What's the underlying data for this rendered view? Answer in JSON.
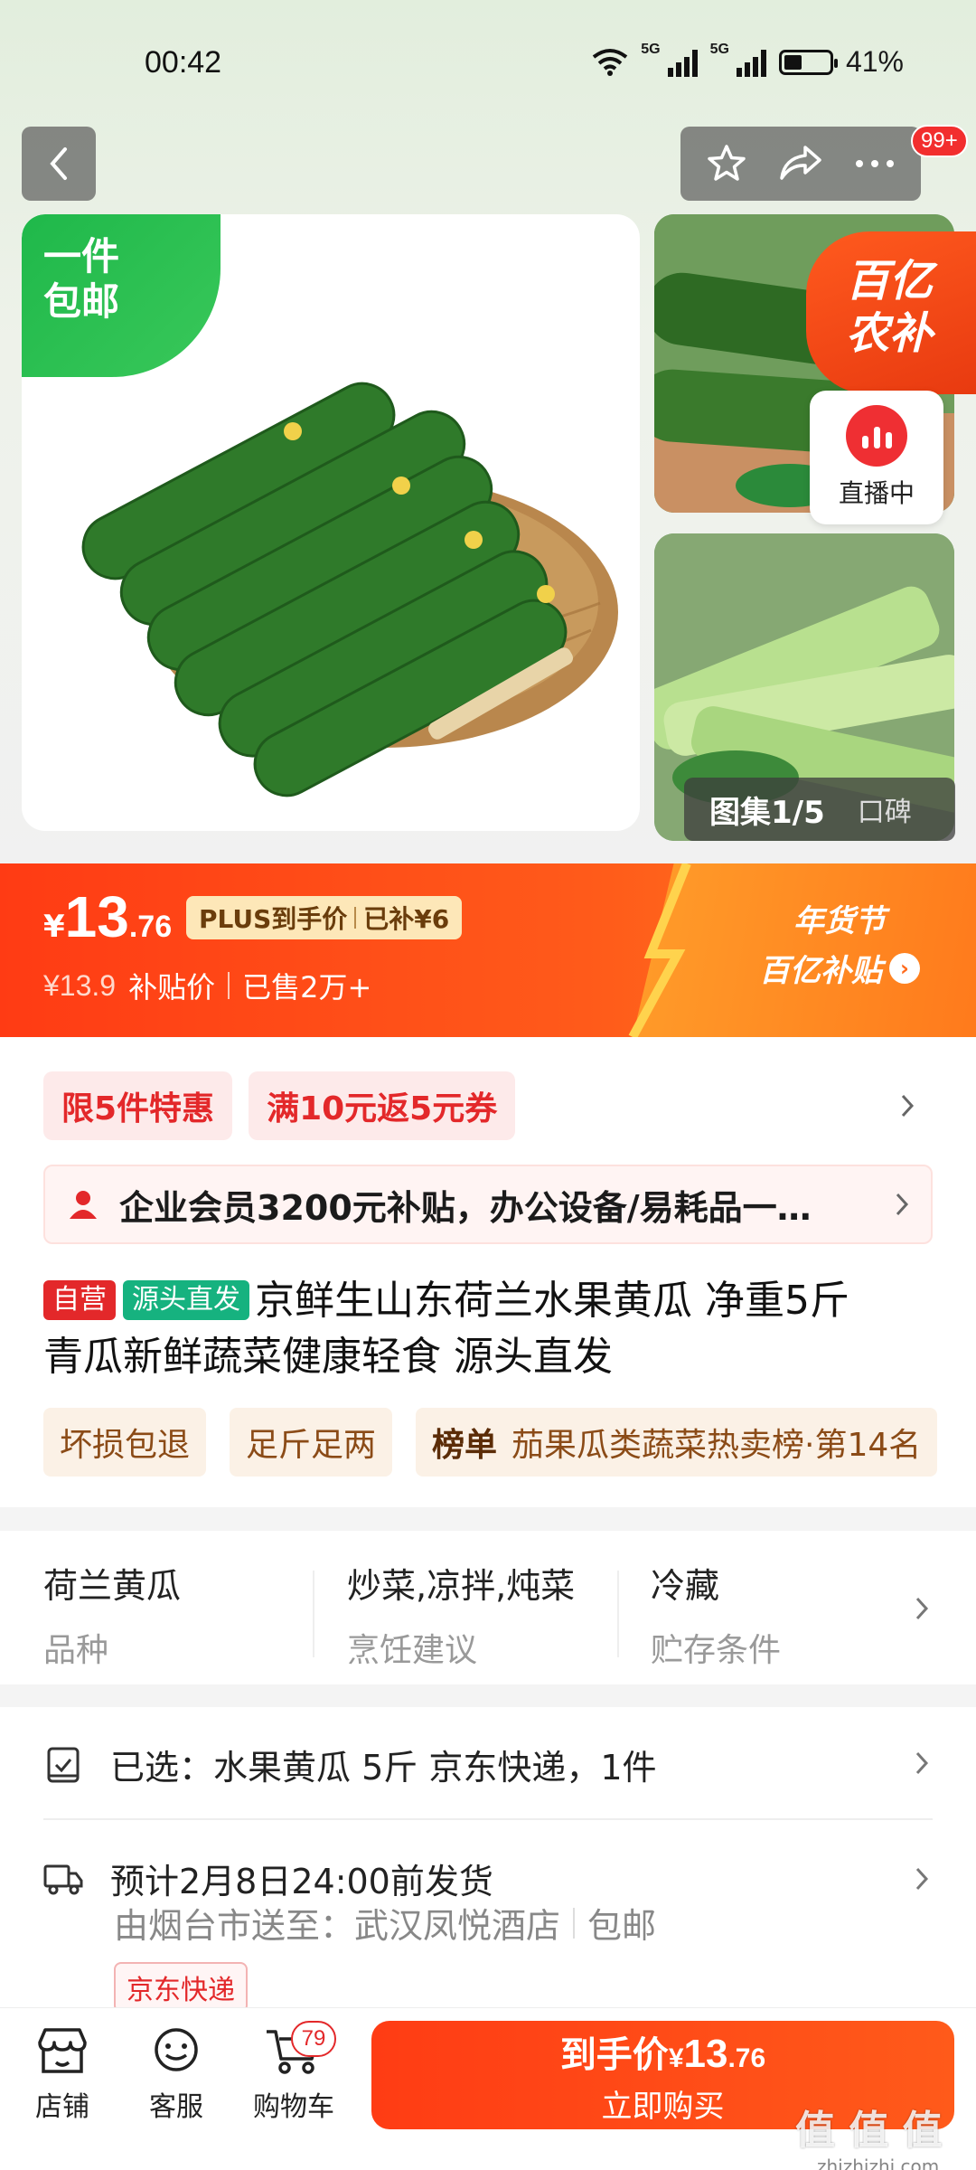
{
  "status_bar": {
    "time": "00:42",
    "network1": "5G",
    "network2": "5G",
    "battery": "41%"
  },
  "nav": {
    "more_badge": "99+"
  },
  "gallery": {
    "free_shipping_line1": "一件",
    "free_shipping_line2": "包邮",
    "counter": "图集1/5",
    "reviews_tab": "口碑",
    "subsidy_line1": "百亿",
    "subsidy_line2": "农补",
    "live_label": "直播中"
  },
  "price": {
    "currency": "¥",
    "integer": "13",
    "decimal": ".76",
    "plus_label": "PLUS到手价",
    "plus_subsidy": "已补¥6",
    "original": "¥13.9",
    "subsidy_label": "补贴价",
    "sold": "已售2万+",
    "festival_line1": "年货节",
    "festival_line2": "百亿补贴"
  },
  "promos": [
    "限5件特惠",
    "满10元返5元券"
  ],
  "enterprise_banner": "企业会员3200元补贴，办公设备/易耗品一…",
  "product": {
    "tag_self": "自营",
    "tag_origin": "源头直发",
    "title_line1": "京鲜生山东荷兰水果黄瓜 净重5斤",
    "title_line2": "青瓜新鲜蔬菜健康轻食 源头直发"
  },
  "features": {
    "items": [
      "坏损包退",
      "足斤足两"
    ],
    "rank_label": "榜单",
    "rank_text": "茄果瓜类蔬菜热卖榜·第14名"
  },
  "specs": [
    {
      "value": "荷兰黄瓜",
      "key": "品种"
    },
    {
      "value": "炒菜,凉拌,炖菜",
      "key": "烹饪建议"
    },
    {
      "value": "冷藏",
      "key": "贮存条件"
    }
  ],
  "delivery": {
    "selected": "已选：水果黄瓜 5斤 京东快递，1件",
    "ship_time": "预计2月8日24:00前发货",
    "ship_from": "由烟台市送至：武汉凤悦酒店",
    "ship_free": "包邮",
    "carrier": "京东快递"
  },
  "bottom_bar": {
    "store": "店铺",
    "service": "客服",
    "cart": "购物车",
    "cart_count": "79",
    "buy_prefix": "到手价",
    "buy_currency": "¥",
    "buy_integer": "13",
    "buy_decimal": ".76",
    "buy_label": "立即购买"
  },
  "watermark": {
    "main": "值 值 值",
    "sub": "zhizhizhi.com"
  },
  "colors": {
    "accent": "#ff3c14",
    "green": "#1fb84a",
    "red_text": "#e3282a"
  }
}
